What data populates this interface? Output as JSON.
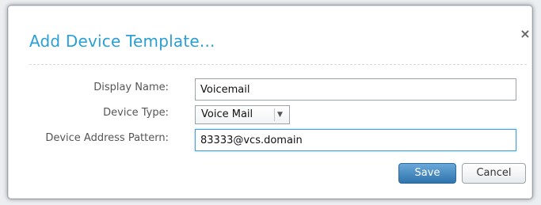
{
  "dialog": {
    "title": "Add Device Template...",
    "close_glyph": "×",
    "close_icon": "close-icon"
  },
  "form": {
    "display_name": {
      "label": "Display Name:",
      "value": "Voicemail"
    },
    "device_type": {
      "label": "Device Type:",
      "selected": "Voice Mail",
      "arrow_glyph": "▼",
      "arrow_icon": "chevron-down-icon"
    },
    "device_address_pattern": {
      "label": "Device Address Pattern:",
      "value": "83333@vcs.domain"
    }
  },
  "buttons": {
    "save_label": "Save",
    "cancel_label": "Cancel"
  },
  "colors": {
    "title": "#2a9fd6",
    "primary_button": "#2f74ad"
  }
}
